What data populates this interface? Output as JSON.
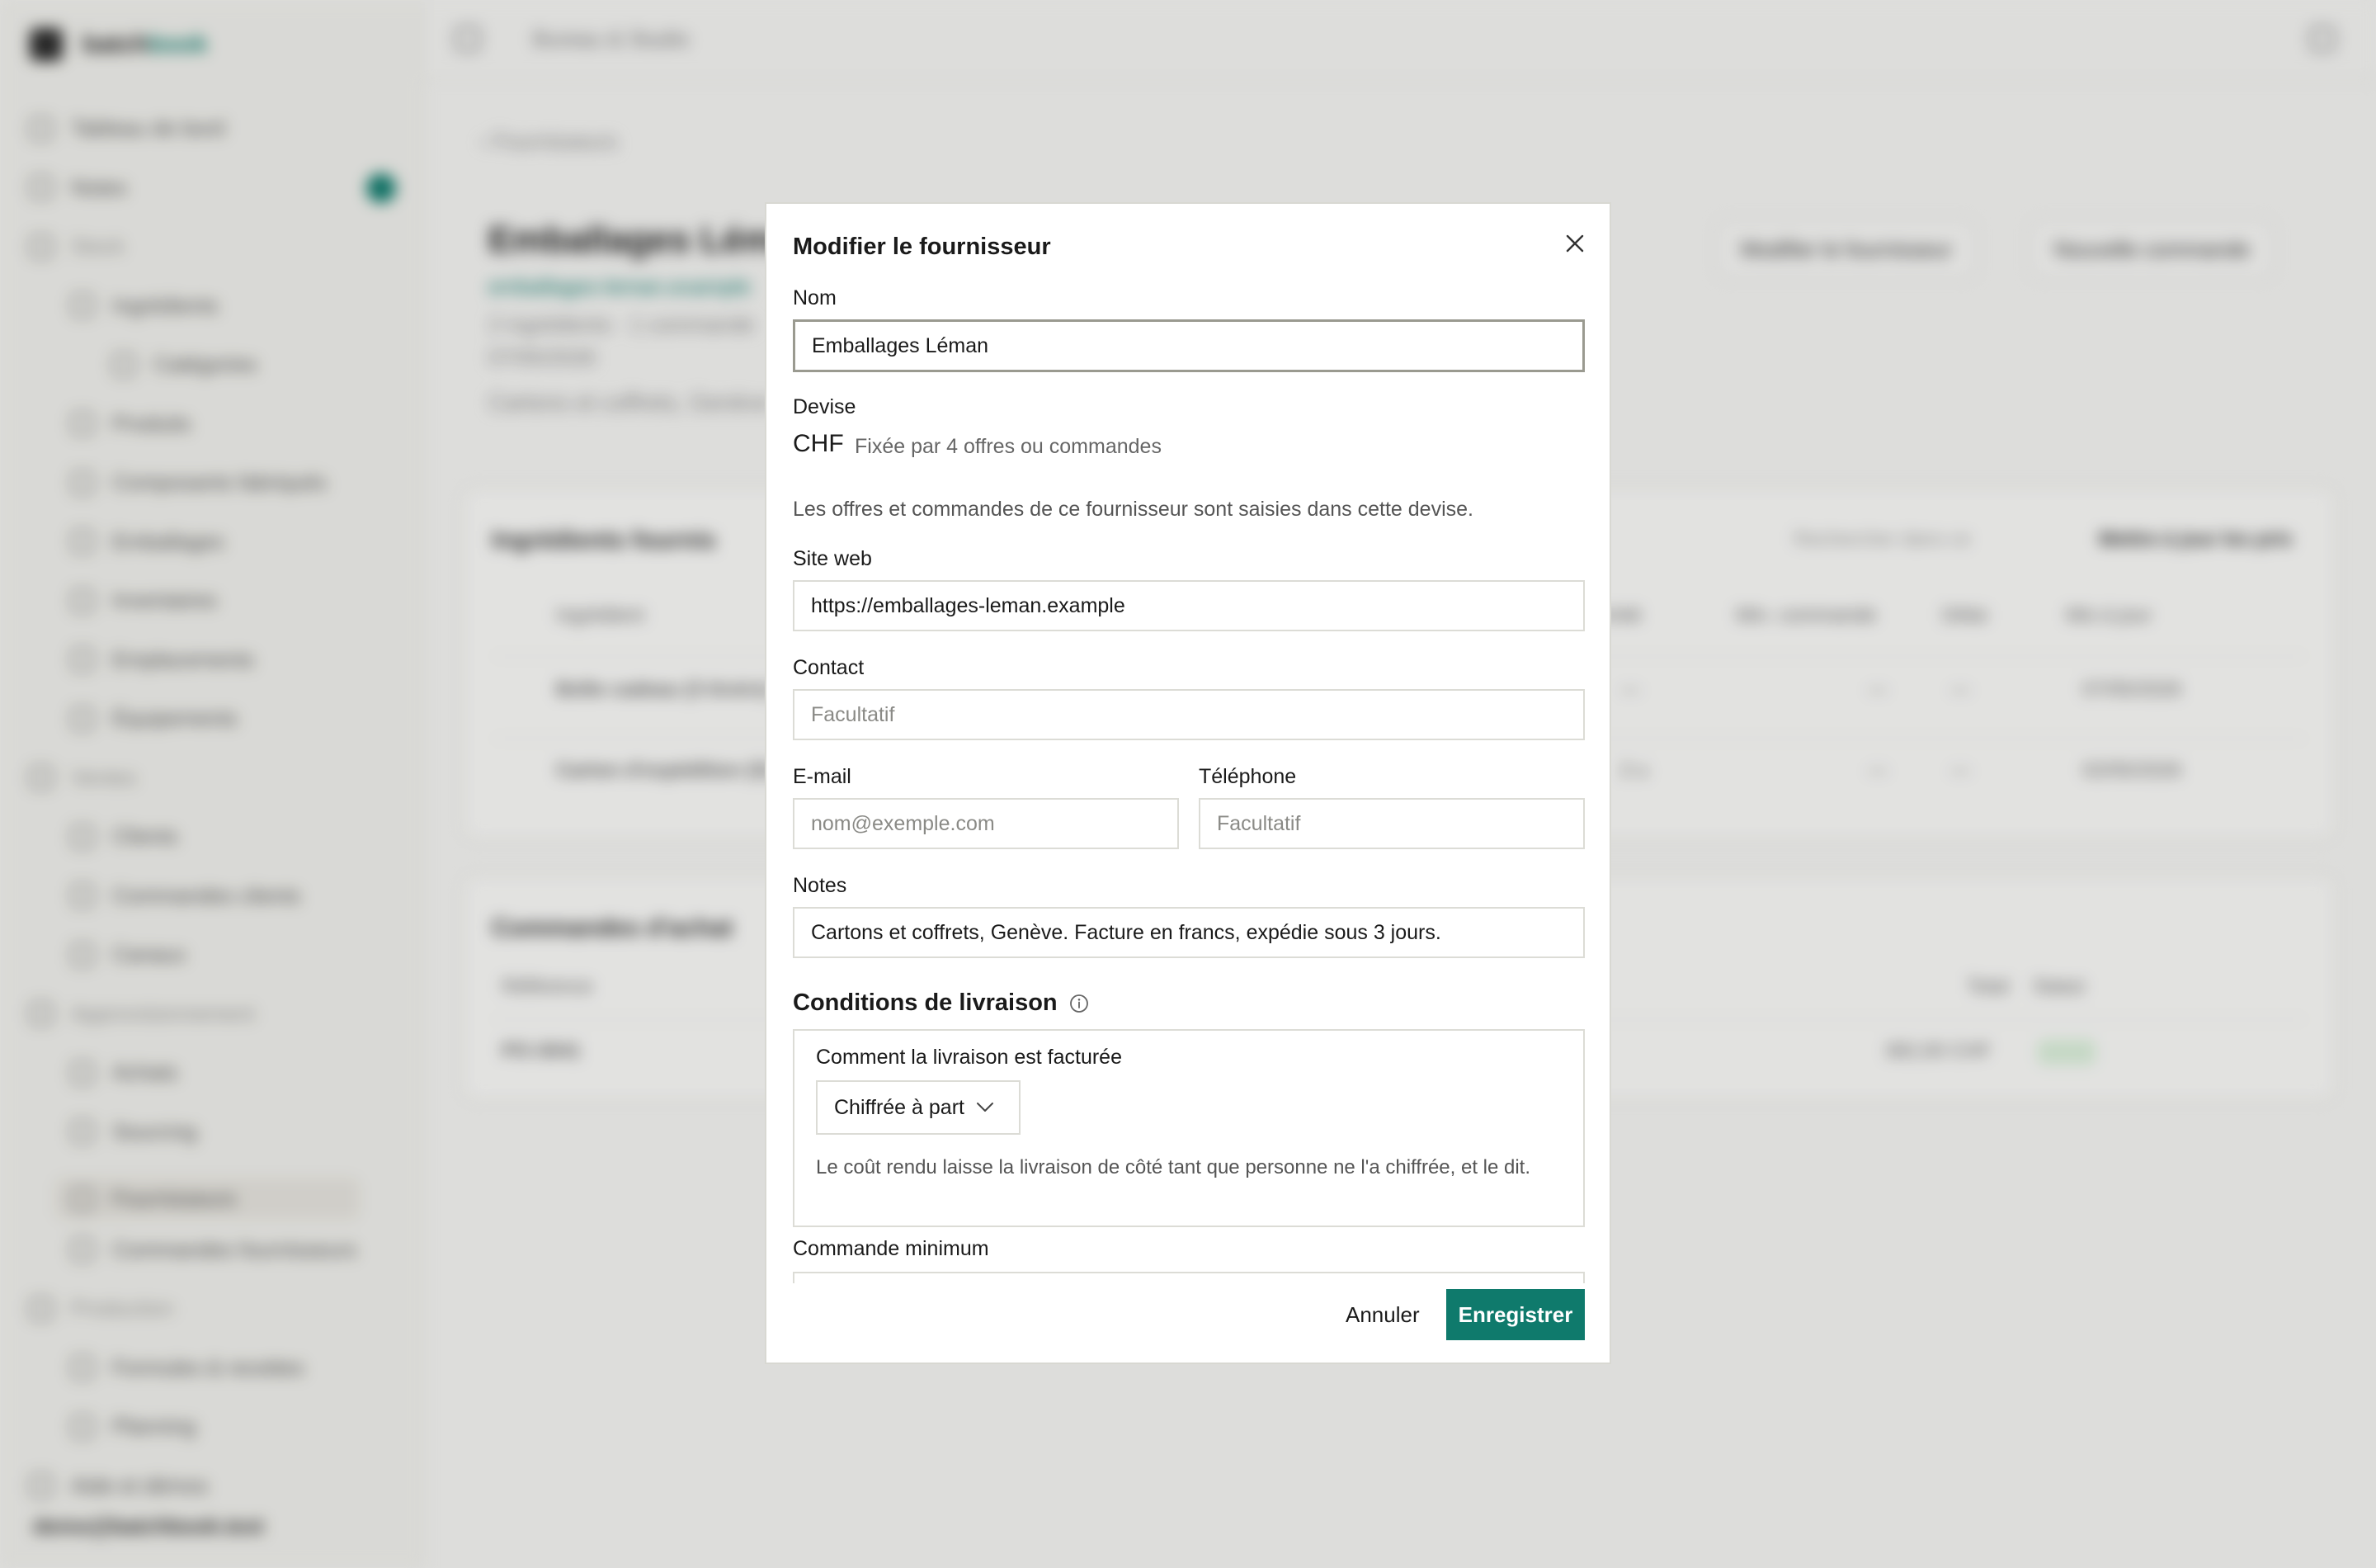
{
  "app": {
    "brand_a": "batch",
    "brand_b": "book",
    "breadcrumb": "Bureau & Studio",
    "user_email": "demo@batchbook.test"
  },
  "sidebar": {
    "items": [
      {
        "label": "Tableau de bord",
        "kind": "item"
      },
      {
        "label": "Notes",
        "kind": "item"
      },
      {
        "label": "Stock",
        "kind": "group"
      },
      {
        "label": "Ingrédients",
        "kind": "sub"
      },
      {
        "label": "Catégories",
        "kind": "sub2"
      },
      {
        "label": "Produits",
        "kind": "sub"
      },
      {
        "label": "Composants fabriqués",
        "kind": "sub"
      },
      {
        "label": "Emballages",
        "kind": "sub"
      },
      {
        "label": "Inventaires",
        "kind": "sub"
      },
      {
        "label": "Emplacements",
        "kind": "sub"
      },
      {
        "label": "Équipements",
        "kind": "sub"
      },
      {
        "label": "Ventes",
        "kind": "group"
      },
      {
        "label": "Clients",
        "kind": "sub"
      },
      {
        "label": "Commandes clients",
        "kind": "sub"
      },
      {
        "label": "Canaux",
        "kind": "sub"
      },
      {
        "label": "Approvisionnement",
        "kind": "group"
      },
      {
        "label": "Achats",
        "kind": "sub"
      },
      {
        "label": "Sourcing",
        "kind": "sub"
      },
      {
        "label": "Fournisseurs",
        "kind": "sub"
      },
      {
        "label": "Commandes fournisseurs",
        "kind": "sub"
      },
      {
        "label": "Production",
        "kind": "group"
      },
      {
        "label": "Formules & recettes",
        "kind": "sub"
      },
      {
        "label": "Planning",
        "kind": "sub"
      },
      {
        "label": "Aide et démos",
        "kind": "item"
      }
    ]
  },
  "page": {
    "back_label": "Fournisseurs",
    "supplier_name": "Emballages Léman",
    "supplier_url": "emballages-leman.example",
    "supplier_meta": "2 ingrédients · 1 commande",
    "supplier_date": "07/05/2026",
    "supplier_notes": "Cartons et coffrets, Genève",
    "edit_button": "Modifier le fournisseur",
    "new_order_button": "Nouvelle commande",
    "ingredients_title": "Ingrédients fournis",
    "search_placeholder": "Rechercher dans ce",
    "update_prices": "Mettre à jour les prix",
    "ing_cols": [
      "Ingrédient",
      "Unité",
      "Min. commande",
      "Délai",
      "Mis à jour"
    ],
    "ing_rows": [
      {
        "name": "Boîte cadeau (3 tiroirs)",
        "unit": "—",
        "min": "—",
        "lead": "—",
        "date": "07/05/2026"
      },
      {
        "name": "Carton d'expédition (S)",
        "unit": "2 u",
        "min": "—",
        "lead": "—",
        "date": "02/05/2026"
      }
    ],
    "orders_title": "Commandes d'achat",
    "order_cols": [
      "Référence",
      "Total",
      "Statut"
    ],
    "order_row": {
      "ref": "PO-3041",
      "total": "382,00 CHF"
    }
  },
  "modal": {
    "title": "Modifier le fournisseur",
    "name_label": "Nom",
    "name_value": "Emballages Léman",
    "currency_label": "Devise",
    "currency_code": "CHF",
    "currency_note": "Fixée par 4 offres ou commandes",
    "currency_help": "Les offres et commandes de ce fournisseur sont saisies dans cette devise.",
    "website_label": "Site web",
    "website_value": "https://emballages-leman.example",
    "contact_label": "Contact",
    "contact_placeholder": "Facultatif",
    "email_label": "E-mail",
    "email_placeholder": "nom@exemple.com",
    "phone_label": "Téléphone",
    "phone_placeholder": "Facultatif",
    "notes_label": "Notes",
    "notes_value": "Cartons et coffrets, Genève. Facture en francs, expédie sous 3 jours.",
    "delivery_title": "Conditions de livraison",
    "delivery_billing_label": "Comment la livraison est facturée",
    "delivery_billing_value": "Chiffrée à part",
    "delivery_help": "Le coût rendu laisse la livraison de côté tant que personne ne l'a chiffrée, et le dit.",
    "min_order_label": "Commande minimum",
    "cancel_label": "Annuler",
    "save_label": "Enregistrer"
  },
  "colors": {
    "accent": "#0f7a6c",
    "overlay": "rgba(20,20,20,0.10)"
  }
}
